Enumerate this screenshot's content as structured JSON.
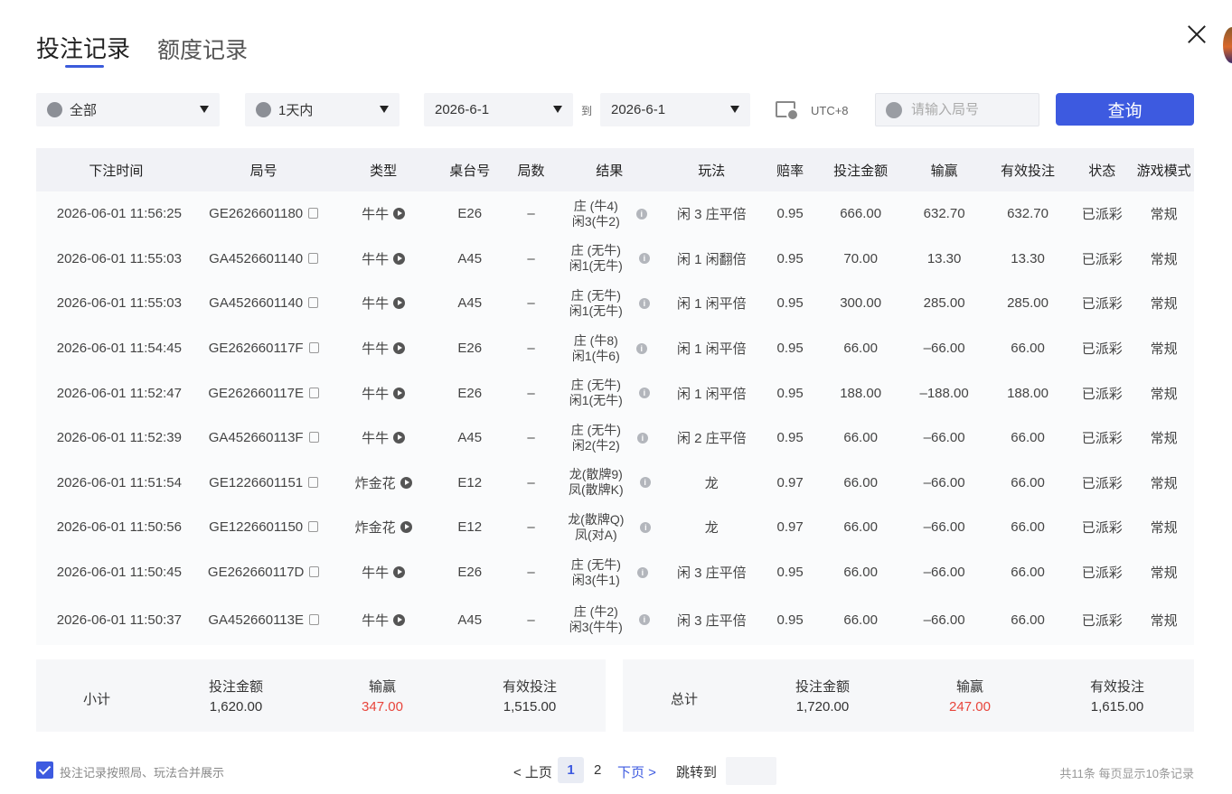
{
  "tabs": {
    "active": "投注记录",
    "inactive": "额度记录"
  },
  "filters": {
    "type": "全部",
    "range": "1天内",
    "date_from": "2026-6-1",
    "to_label": "到",
    "date_to": "2026-6-1",
    "timezone": "UTC+8",
    "round_placeholder": "请输入局号",
    "query_label": "查询"
  },
  "table": {
    "headers": [
      "下注时间",
      "局号",
      "类型",
      "桌台号",
      "局数",
      "结果",
      "玩法",
      "赔率",
      "投注金额",
      "输赢",
      "有效投注",
      "状态",
      "游戏模式"
    ],
    "rows": [
      {
        "time": "2026-06-01 11:56:25",
        "round": "GE2626601180",
        "type": "牛牛",
        "table": "E26",
        "shoe": "–",
        "r1": "庄 (牛4)",
        "r2": "闲3(牛2)",
        "play": "闲 3 庄平倍",
        "odds": "0.95",
        "bet": "666.00",
        "win": "632.70",
        "win_state": "win",
        "valid": "632.70",
        "status": "已派彩",
        "mode": "常规"
      },
      {
        "time": "2026-06-01 11:55:03",
        "round": "GA4526601140",
        "type": "牛牛",
        "table": "A45",
        "shoe": "–",
        "r1": "庄 (无牛)",
        "r2": "闲1(无牛)",
        "play": "闲 1 闲翻倍",
        "odds": "0.95",
        "bet": "70.00",
        "win": "13.30",
        "win_state": "win",
        "valid": "13.30",
        "status": "已派彩",
        "mode": "常规"
      },
      {
        "time": "2026-06-01 11:55:03",
        "round": "GA4526601140",
        "type": "牛牛",
        "table": "A45",
        "shoe": "–",
        "r1": "庄 (无牛)",
        "r2": "闲1(无牛)",
        "play": "闲 1 闲平倍",
        "odds": "0.95",
        "bet": "300.00",
        "win": "285.00",
        "win_state": "win",
        "valid": "285.00",
        "status": "已派彩",
        "mode": "常规"
      },
      {
        "time": "2026-06-01 11:54:45",
        "round": "GE262660117F",
        "type": "牛牛",
        "table": "E26",
        "shoe": "–",
        "r1": "庄 (牛8)",
        "r2": "闲1(牛6)",
        "play": "闲 1 闲平倍",
        "odds": "0.95",
        "bet": "66.00",
        "win": "–66.00",
        "win_state": "lose",
        "valid": "66.00",
        "status": "已派彩",
        "mode": "常规"
      },
      {
        "time": "2026-06-01 11:52:47",
        "round": "GE262660117E",
        "type": "牛牛",
        "table": "E26",
        "shoe": "–",
        "r1": "庄 (无牛)",
        "r2": "闲1(无牛)",
        "play": "闲 1 闲平倍",
        "odds": "0.95",
        "bet": "188.00",
        "win": "–188.00",
        "win_state": "lose",
        "valid": "188.00",
        "status": "已派彩",
        "mode": "常规"
      },
      {
        "time": "2026-06-01 11:52:39",
        "round": "GA452660113F",
        "type": "牛牛",
        "table": "A45",
        "shoe": "–",
        "r1": "庄 (无牛)",
        "r2": "闲2(牛2)",
        "play": "闲 2 庄平倍",
        "odds": "0.95",
        "bet": "66.00",
        "win": "–66.00",
        "win_state": "lose",
        "valid": "66.00",
        "status": "已派彩",
        "mode": "常规"
      },
      {
        "time": "2026-06-01 11:51:54",
        "round": "GE1226601151",
        "type": "炸金花",
        "table": "E12",
        "shoe": "–",
        "r1": "龙(散牌9)",
        "r2": "凤(散牌K)",
        "play": "龙",
        "odds": "0.97",
        "bet": "66.00",
        "win": "–66.00",
        "win_state": "lose",
        "valid": "66.00",
        "status": "已派彩",
        "mode": "常规"
      },
      {
        "time": "2026-06-01 11:50:56",
        "round": "GE1226601150",
        "type": "炸金花",
        "table": "E12",
        "shoe": "–",
        "r1": "龙(散牌Q)",
        "r2": "凤(对A)",
        "play": "龙",
        "odds": "0.97",
        "bet": "66.00",
        "win": "–66.00",
        "win_state": "lose",
        "valid": "66.00",
        "status": "已派彩",
        "mode": "常规"
      },
      {
        "time": "2026-06-01 11:50:45",
        "round": "GE262660117D",
        "type": "牛牛",
        "table": "E26",
        "shoe": "–",
        "r1": "庄 (无牛)",
        "r2": "闲3(牛1)",
        "play": "闲 3 庄平倍",
        "odds": "0.95",
        "bet": "66.00",
        "win": "–66.00",
        "win_state": "lose",
        "valid": "66.00",
        "status": "已派彩",
        "mode": "常规"
      },
      {
        "time": "2026-06-01 11:50:37",
        "round": "GA452660113E",
        "type": "牛牛",
        "table": "A45",
        "shoe": "–",
        "r1": "庄 (牛2)",
        "r2": "闲3(牛牛)",
        "play": "闲 3 庄平倍",
        "odds": "0.95",
        "bet": "66.00",
        "win": "–66.00",
        "win_state": "lose",
        "valid": "66.00",
        "status": "已派彩",
        "mode": "常规"
      }
    ]
  },
  "subtotal": {
    "label": "小计",
    "bet_label": "投注金额",
    "bet": "1,620.00",
    "win_label": "输赢",
    "win": "347.00",
    "valid_label": "有效投注",
    "valid": "1,515.00"
  },
  "total": {
    "label": "总计",
    "bet_label": "投注金额",
    "bet": "1,720.00",
    "win_label": "输赢",
    "win": "247.00",
    "valid_label": "有效投注",
    "valid": "1,615.00"
  },
  "footer": {
    "merge_label": "投注记录按照局、玩法合并展示",
    "prev": "< 上页",
    "page1": "1",
    "page2": "2",
    "next": "下页 >",
    "jump": "跳转到",
    "meta": "共11条  每页显示10条记录"
  },
  "colors": {
    "accent": "#3d5ae0",
    "win": "#e8453c",
    "lose": "#1aaa4a"
  }
}
